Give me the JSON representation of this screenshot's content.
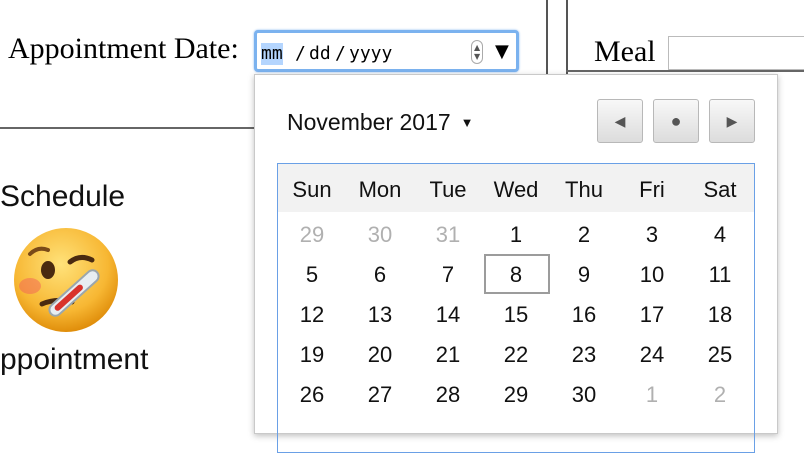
{
  "form": {
    "appointment_label": "Appointment Date:",
    "date_field": {
      "month": "mm",
      "sep1": "/",
      "day": "dd",
      "sep2": "/",
      "year": "yyyy"
    },
    "meal_label": "Meal"
  },
  "sidebar": {
    "heading": "Schedule",
    "footer": "ppointment",
    "emoji_icon": "face-with-thermometer-icon"
  },
  "calendar": {
    "month_label": "November 2017",
    "nav": {
      "prev_icon": "triangle-left-icon",
      "today_icon": "dot-icon",
      "next_icon": "triangle-right-icon"
    },
    "weekdays": [
      "Sun",
      "Mon",
      "Tue",
      "Wed",
      "Thu",
      "Fri",
      "Sat"
    ],
    "weeks": [
      [
        "29",
        "30",
        "31",
        "1",
        "2",
        "3",
        "4"
      ],
      [
        "5",
        "6",
        "7",
        "8",
        "9",
        "10",
        "11"
      ],
      [
        "12",
        "13",
        "14",
        "15",
        "16",
        "17",
        "18"
      ],
      [
        "19",
        "20",
        "21",
        "22",
        "23",
        "24",
        "25"
      ],
      [
        "26",
        "27",
        "28",
        "29",
        "30",
        "1",
        "2"
      ]
    ],
    "other_month": [
      [
        true,
        true,
        true,
        false,
        false,
        false,
        false
      ],
      [
        false,
        false,
        false,
        false,
        false,
        false,
        false
      ],
      [
        false,
        false,
        false,
        false,
        false,
        false,
        false
      ],
      [
        false,
        false,
        false,
        false,
        false,
        false,
        false
      ],
      [
        false,
        false,
        false,
        false,
        false,
        true,
        true
      ]
    ],
    "highlighted_day": "8"
  }
}
